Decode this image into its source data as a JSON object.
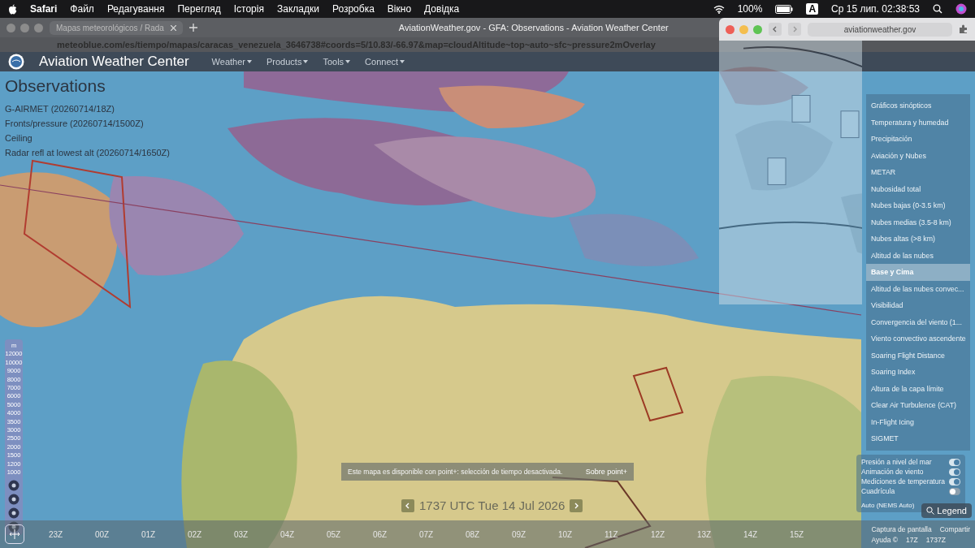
{
  "menu_bar": {
    "app": "Safari",
    "menus": [
      "Файл",
      "Редагування",
      "Перегляд",
      "Історія",
      "Закладки",
      "Розробка",
      "Вікно",
      "Довідка"
    ],
    "battery": "100%",
    "input_source": "A",
    "clock": "Ср 15 лип. 02:38:53"
  },
  "browser": {
    "tab_title": "Mapas meteorológicos / Rada",
    "window_title": "AviationWeather.gov - GFA: Observations - Aviation Weather Center",
    "url": "meteoblue.com/es/tiempo/mapas/caracas_venezuela_3646738#coords=5/10.83/-66.97&map=cloudAltitude~top~auto~sfc~pressure2mOverlay"
  },
  "site_header": {
    "title": "Aviation Weather Center",
    "nav": [
      "Weather",
      "Products",
      "Tools",
      "Connect"
    ]
  },
  "observations": {
    "title": "Observations",
    "layers": [
      "G-AIRMET (20260714/18Z)",
      "Fronts/pressure (20260714/1500Z)",
      "Ceiling",
      "Radar refl at lowest alt (20260714/1650Z)"
    ]
  },
  "altitude_legend": {
    "unit": "m",
    "values": [
      "12000",
      "10000",
      "9000",
      "8000",
      "7000",
      "6000",
      "5000",
      "4000",
      "3500",
      "3000",
      "2500",
      "2000",
      "1500",
      "1200",
      "1000"
    ]
  },
  "layer_menu": {
    "items": [
      {
        "label": "Gráficos sinópticos",
        "selected": false
      },
      {
        "label": "Temperatura y humedad",
        "selected": false
      },
      {
        "label": "Precipitación",
        "selected": false
      },
      {
        "label": "Aviación y Nubes",
        "selected": false
      },
      {
        "label": "METAR",
        "selected": false
      },
      {
        "label": "Nubosidad total",
        "selected": false
      },
      {
        "label": "Nubes bajas (0-3.5 km)",
        "selected": false
      },
      {
        "label": "Nubes medias (3.5-8 km)",
        "selected": false
      },
      {
        "label": "Nubes altas (>8 km)",
        "selected": false
      },
      {
        "label": "Altitud de las nubes",
        "selected": false
      },
      {
        "label": "Base y Cima",
        "selected": true
      },
      {
        "label": "Altitud de las nubes convec...",
        "selected": false
      },
      {
        "label": "Visibilidad",
        "selected": false
      },
      {
        "label": "Convergencia del viento (1...",
        "selected": false
      },
      {
        "label": "Viento convectivo ascendente",
        "selected": false
      },
      {
        "label": "Soaring Flight Distance",
        "selected": false
      },
      {
        "label": "Soaring Index",
        "selected": false
      },
      {
        "label": "Altura de la capa límite",
        "selected": false
      },
      {
        "label": "Clear Air Turbulence (CAT)",
        "selected": false
      },
      {
        "label": "In-Flight Icing",
        "selected": false
      },
      {
        "label": "SIGMET",
        "selected": false
      }
    ]
  },
  "overlay_toggles": [
    {
      "label": "Presión a nivel del mar",
      "on": true
    },
    {
      "label": "Animación de viento",
      "on": true
    },
    {
      "label": "Mediciones de temperatura",
      "on": true
    },
    {
      "label": "Cuadrícula",
      "on": false
    }
  ],
  "model": "Auto (NEMS Auto)",
  "legend_button": "Legend",
  "notice": {
    "text": "Este mapa es disponible con point+: selección de tiempo desactivada.",
    "link": "Sobre point+"
  },
  "time_nav": "1737 UTC Tue 14 Jul 2026",
  "timeline": {
    "hours": [
      "23Z",
      "00Z",
      "01Z",
      "02Z",
      "03Z",
      "04Z",
      "05Z",
      "06Z",
      "07Z",
      "08Z",
      "09Z",
      "10Z",
      "11Z",
      "12Z",
      "13Z",
      "14Z",
      "15Z"
    ],
    "current_hour": "17Z",
    "current_time": "1737Z"
  },
  "footer_links": [
    "Captura de pantalla",
    "Compartir",
    "Ayuda",
    "©"
  ],
  "popup_window": {
    "url": "aviationweather.gov"
  }
}
